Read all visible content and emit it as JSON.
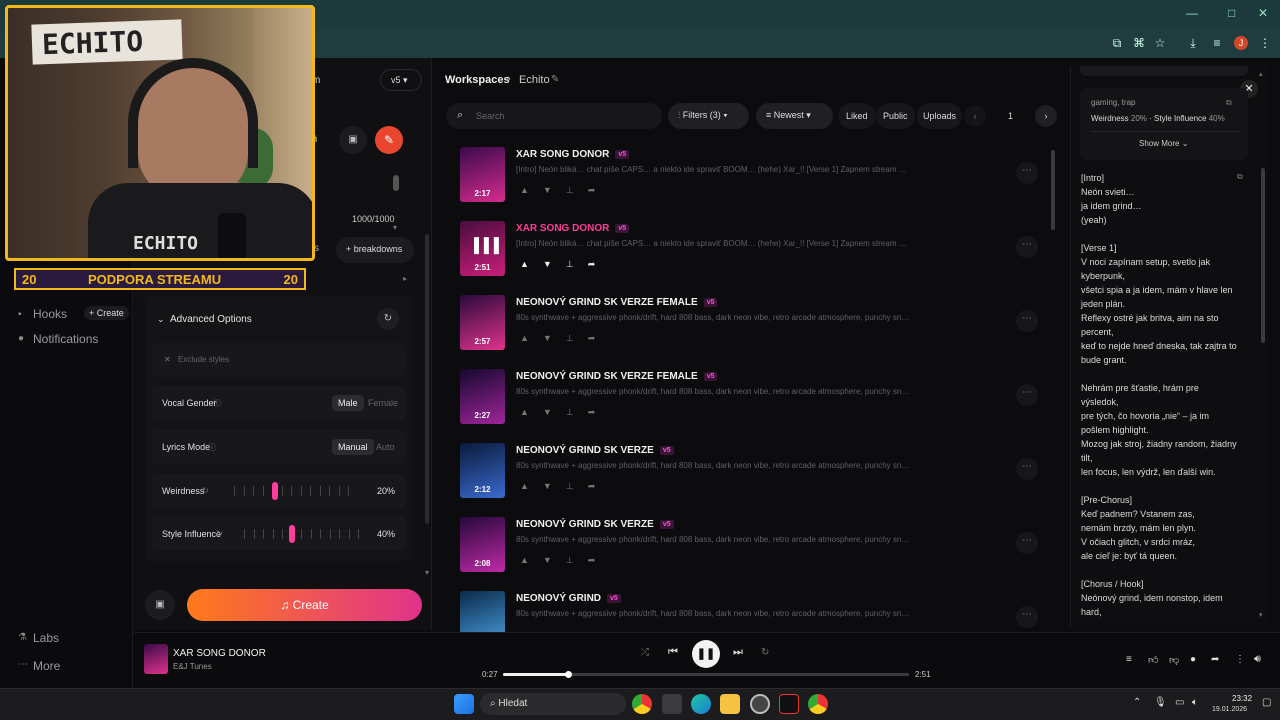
{
  "browser": {
    "controls": [
      "—",
      "□",
      "✕"
    ],
    "profile_initial": "J"
  },
  "overlay": {
    "logo_text": "ECHITO",
    "shirt_text": "ECHITO",
    "banner_left": "20",
    "banner_text": "PODPORA STREAMU",
    "banner_right": "20"
  },
  "panel": {
    "mode_fragment": "m",
    "version": "v5",
    "counter": "1000/1000",
    "pill_fragment": "s",
    "breakdowns": "breakdowns"
  },
  "sidebar": {
    "hooks": "Hooks",
    "create_chip": "+ Create",
    "notifications": "Notifications",
    "labs": "Labs",
    "more": "More"
  },
  "advanced": {
    "title": "Advanced Options",
    "exclude_placeholder": "Exclude styles",
    "vocal_gender": {
      "label": "Vocal Gender",
      "opt_on": "Male",
      "opt_off": "Female"
    },
    "lyrics_mode": {
      "label": "Lyrics Mode",
      "opt_on": "Manual",
      "opt_off": "Auto"
    },
    "weirdness": {
      "label": "Weirdness",
      "value": "20%",
      "level": 0.2
    },
    "style_influence": {
      "label": "Style Influence",
      "value": "40%",
      "level": 0.4
    },
    "create_label": "Create"
  },
  "breadcrumb": {
    "root": "Workspaces",
    "current": "Echito"
  },
  "toolbar": {
    "search_placeholder": "Search",
    "filters": "Filters (3)",
    "sort": "Newest",
    "liked": "Liked",
    "public": "Public",
    "uploads": "Uploads",
    "page": "1"
  },
  "songs": [
    {
      "title": "XAR SONG DONOR",
      "badge": "v5",
      "desc": "[Intro] Neón bliká… chat píše CAPS… a niekto ide spraviť BOOM… (hehe) Xar_!! [Verse 1] Zapnem stream a tvárim sa: \"...",
      "dur": "2:17",
      "active": false,
      "color_a": "#3a0a4a",
      "color_b": "#d62b8f"
    },
    {
      "title": "XAR SONG DONOR",
      "badge": "v5",
      "desc": "[Intro] Neón bliká… chat píše CAPS… a niekto ide spraviť BOOM… (hehe) Xar_!! [Verse 1] Zapnem stream a tvárim sa: \"...",
      "dur": "2:51",
      "active": true,
      "color_a": "#4a0d3e",
      "color_b": "#c91f7a"
    },
    {
      "title": "NEONOVÝ GRIND SK VERZE FEMALE",
      "badge": "v5",
      "desc": "80s synthwave + aggressive phonk/drift, hard 808 bass, dark neon vibe, retro arcade atmosphere, punchy snare, co...",
      "dur": "2:57",
      "active": false,
      "color_a": "#2a0a3a",
      "color_b": "#e0338c"
    },
    {
      "title": "NEONOVÝ GRIND SK VERZE FEMALE",
      "badge": "v5",
      "desc": "80s synthwave + aggressive phonk/drift, hard 808 bass, dark neon vibe, retro arcade atmosphere, punchy snare, co...",
      "dur": "2:27",
      "active": false,
      "color_a": "#15082e",
      "color_b": "#a0259a"
    },
    {
      "title": "NEONOVÝ GRIND SK VERZE",
      "badge": "v5",
      "desc": "80s synthwave + aggressive phonk/drift, hard 808 bass, dark neon vibe, retro arcade atmosphere, punchy snare, co...",
      "dur": "2:12",
      "active": false,
      "color_a": "#0a1a3a",
      "color_b": "#3a6ad0"
    },
    {
      "title": "NEONOVÝ GRIND SK VERZE",
      "badge": "v5",
      "desc": "80s synthwave + aggressive phonk/drift, hard 808 bass, dark neon vibe, retro arcade atmosphere, punchy snare, co...",
      "dur": "2:08",
      "active": false,
      "color_a": "#25083a",
      "color_b": "#c02aa8"
    },
    {
      "title": "NEONOVÝ GRIND",
      "badge": "v5",
      "desc": "80s synthwave + aggressive phonk/drift, hard 808 bass, dark neon vibe, retro arcade atmosphere, punchy snare, co...",
      "dur": "",
      "active": false,
      "color_a": "#0a2a4a",
      "color_b": "#4aa0e0"
    }
  ],
  "right": {
    "tags": "gaming, trap",
    "stats_weird_label": "Weirdness",
    "stats_weird_value": "20%",
    "stats_style_label": "Style Influence",
    "stats_style_value": "40%",
    "show_more": "Show More",
    "lyrics": "[Intro]\nNeón svieti…\nja idem grind…\n(yeah)\n\n[Verse 1]\nV noci zapínam setup, svetlo jak\nkyberpunk,\nvšetci spia a ja idem, mám v hlave len\njeden plán.\nReflexy ostré jak britva, aim na sto\npercent,\nkeď to nejde hneď dneska, tak zajtra to\nbude grant.\n\nNehrám pre šťastie, hrám pre\nvýsledok,\npre tých, čo hovoria „nie“ – ja im\npošlem highlight.\nMozog jak stroj, žiadny random, žiadny\ntilt,\nlen focus, len výdrž, len ďalší win.\n\n[Pre-Chorus]\nKeď padnem? Vstanem zas,\nnemám brzdy, mám len plyn.\nV očiach glitch, v srdci mráz,\nale cieľ je: byť tá queen.\n\n[Chorus / Hook]\nNeónový grind, idem nonstop, idem\nhard,"
  },
  "player": {
    "title": "XAR SONG DONOR",
    "artist": "E&J Tunes",
    "elapsed": "0:27",
    "total": "2:51",
    "progress": 0.16
  },
  "taskbar": {
    "search": "Hledat",
    "time": "23:32",
    "date": "19.01.2026"
  },
  "colors": {
    "accent": "#ff3d9a",
    "create_from": "#ff7a1a",
    "create_to": "#e0338c",
    "cam_border": "#f3b91b"
  }
}
